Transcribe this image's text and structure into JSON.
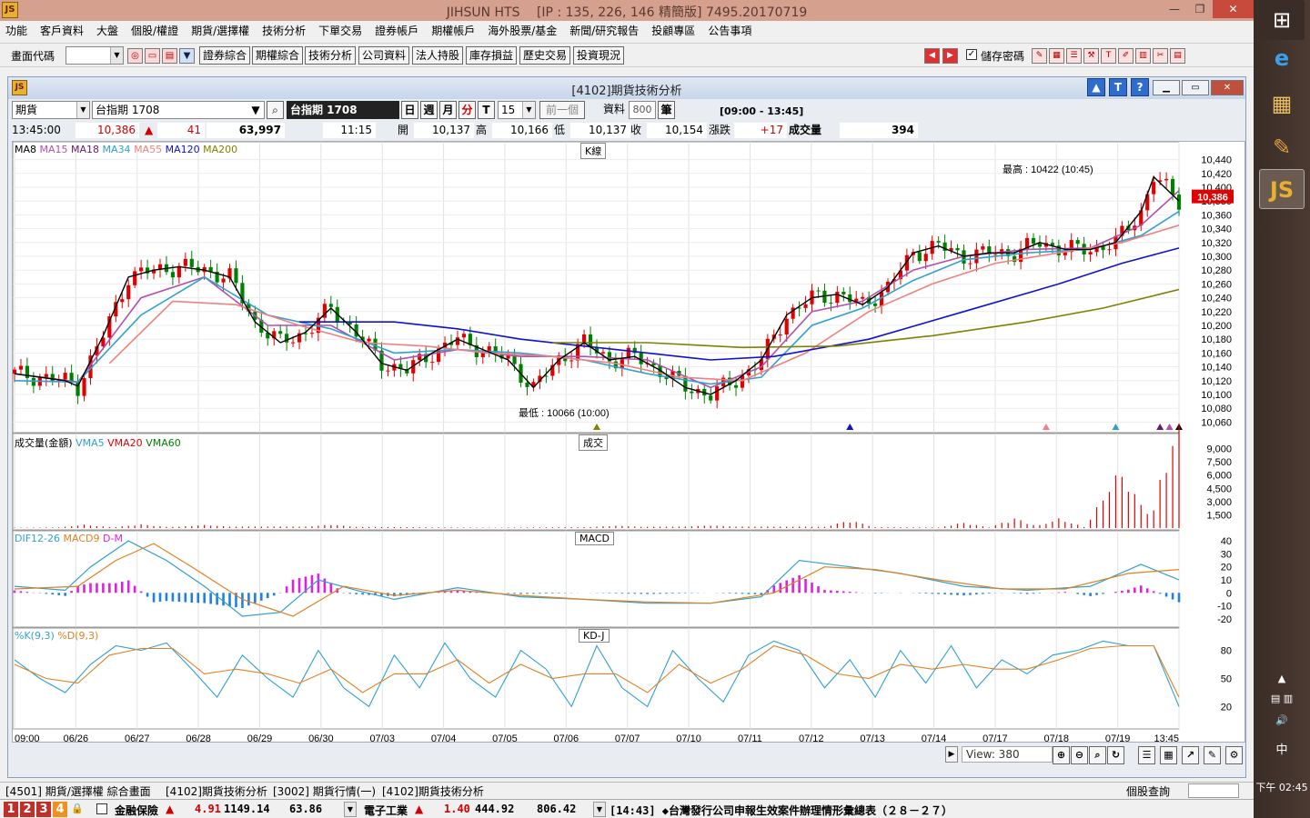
{
  "window": {
    "title": "JIHSUN HTS　  [IP : 135, 226, 146 精簡版] 7495.20170719",
    "logo_text": "JS"
  },
  "menu": [
    "功能",
    "客戶資料",
    "大盤",
    "個股/權證",
    "期貨/選擇權",
    "技術分析",
    "下單交易",
    "證券帳戶",
    "期權帳戶",
    "海外股票/基金",
    "新聞/研究報告",
    "投顧專區",
    "公告事項"
  ],
  "toolbar": {
    "code_label": "畫面代碼",
    "buttons": [
      "證券綜合",
      "期權綜合",
      "技術分析",
      "公司資料",
      "法人持股",
      "庫存損益",
      "歷史交易",
      "投資現況"
    ],
    "save_pw_label": "儲存密碼"
  },
  "child": {
    "title": "[4102]期貨技術分析",
    "market_select": "期貨",
    "contract_select": "台指期 1708",
    "contract_label": "台指期 1708",
    "periods": [
      "日",
      "週",
      "月",
      "分",
      "T"
    ],
    "interval": "15",
    "prev_btn": "前一個",
    "data_label": "資料",
    "data_count": "800",
    "unit_label": "筆",
    "session": "[09:00 - 13:45]"
  },
  "quote": {
    "time": "13:45:00",
    "price": "10,386",
    "change": "41",
    "volume_total": "63,997",
    "bar_time": "11:15",
    "open_label": "開",
    "open": "10,137",
    "high_label": "高",
    "high": "10,166",
    "low_label": "低",
    "low": "10,137",
    "close_label": "收",
    "close": "10,154",
    "chg_label": "漲跌",
    "chg": "+17",
    "vol_label": "成交量",
    "vol": "394"
  },
  "panels": {
    "k": {
      "title": "K線",
      "legend": [
        "MA8",
        "MA15",
        "MA18",
        "MA34",
        "MA55",
        "MA120",
        "MA200"
      ]
    },
    "vol": {
      "title": "成交",
      "legend": [
        "成交量(金額)",
        "VMA5",
        "VMA20",
        "VMA60"
      ]
    },
    "macd": {
      "title": "MACD",
      "legend": [
        "DIF12-26",
        "MACD9",
        "D-M"
      ]
    },
    "kd": {
      "title": "KD-J",
      "legend": [
        "%K(9,3)",
        "%D(9,3)"
      ]
    }
  },
  "colors": {
    "up": "#e00000",
    "down": "#008000",
    "ma8": "#000000",
    "ma15": "#b050b0",
    "ma18": "#6a1a6a",
    "ma34": "#30a0d0",
    "ma55": "#f08080",
    "ma120": "#1010d0",
    "ma200": "#808000",
    "vma5": "#30a0d0",
    "vma20": "#e00000",
    "vma60": "#008000",
    "dif": "#30a0d0",
    "macd": "#e08020",
    "osc_pos": "#e020e0",
    "osc_neg": "#2080e0",
    "k": "#30a0d0",
    "d": "#e08020"
  },
  "chart_data": [
    {
      "type": "line",
      "title": "K線",
      "high_annot": "最高 : 10422 (10:45)",
      "low_annot": "最低 : 10066 (10:00)",
      "last_price": "10,386",
      "y_ticks": [
        "10,440",
        "10,420",
        "10,400",
        "10,380",
        "10,360",
        "10,340",
        "10,320",
        "10,300",
        "10,280",
        "10,260",
        "10,240",
        "10,220",
        "10,200",
        "10,180",
        "10,160",
        "10,140",
        "10,120",
        "10,100",
        "10,080",
        "10,060"
      ],
      "ylim": [
        10050,
        10450
      ],
      "x_ticks": [
        "09:00",
        "06/26",
        "06/27",
        "06/28",
        "06/29",
        "06/30",
        "07/03",
        "07/04",
        "07/05",
        "07/06",
        "07/07",
        "07/10",
        "07/11",
        "07/12",
        "07/13",
        "07/14",
        "07/17",
        "07/18",
        "07/19",
        "13:45"
      ],
      "close_path": [
        [
          0,
          10130
        ],
        [
          4,
          10125
        ],
        [
          8,
          10120
        ],
        [
          10,
          10112
        ],
        [
          14,
          10185
        ],
        [
          18,
          10270
        ],
        [
          22,
          10280
        ],
        [
          26,
          10285
        ],
        [
          30,
          10280
        ],
        [
          34,
          10270
        ],
        [
          38,
          10205
        ],
        [
          42,
          10175
        ],
        [
          46,
          10190
        ],
        [
          50,
          10225
        ],
        [
          54,
          10190
        ],
        [
          58,
          10145
        ],
        [
          62,
          10135
        ],
        [
          66,
          10160
        ],
        [
          70,
          10180
        ],
        [
          74,
          10165
        ],
        [
          78,
          10150
        ],
        [
          82,
          10110
        ],
        [
          86,
          10150
        ],
        [
          90,
          10175
        ],
        [
          94,
          10150
        ],
        [
          98,
          10155
        ],
        [
          102,
          10135
        ],
        [
          106,
          10110
        ],
        [
          110,
          10100
        ],
        [
          114,
          10120
        ],
        [
          118,
          10150
        ],
        [
          122,
          10215
        ],
        [
          126,
          10240
        ],
        [
          130,
          10245
        ],
        [
          134,
          10230
        ],
        [
          138,
          10255
        ],
        [
          142,
          10305
        ],
        [
          146,
          10315
        ],
        [
          150,
          10300
        ],
        [
          154,
          10305
        ],
        [
          158,
          10305
        ],
        [
          162,
          10320
        ],
        [
          166,
          10310
        ],
        [
          170,
          10310
        ],
        [
          174,
          10320
        ],
        [
          178,
          10365
        ],
        [
          180,
          10415
        ],
        [
          184,
          10380
        ]
      ],
      "ma_paths": {
        "ma15": [
          [
            0,
            10130
          ],
          [
            10,
            10118
          ],
          [
            20,
            10240
          ],
          [
            30,
            10270
          ],
          [
            40,
            10200
          ],
          [
            50,
            10200
          ],
          [
            60,
            10150
          ],
          [
            70,
            10165
          ],
          [
            80,
            10155
          ],
          [
            90,
            10155
          ],
          [
            100,
            10150
          ],
          [
            110,
            10110
          ],
          [
            118,
            10140
          ],
          [
            126,
            10220
          ],
          [
            134,
            10235
          ],
          [
            142,
            10280
          ],
          [
            150,
            10300
          ],
          [
            160,
            10310
          ],
          [
            170,
            10312
          ],
          [
            178,
            10345
          ],
          [
            184,
            10395
          ]
        ],
        "ma34": [
          [
            0,
            10120
          ],
          [
            10,
            10118
          ],
          [
            20,
            10215
          ],
          [
            30,
            10270
          ],
          [
            40,
            10215
          ],
          [
            50,
            10195
          ],
          [
            60,
            10160
          ],
          [
            70,
            10165
          ],
          [
            80,
            10160
          ],
          [
            90,
            10150
          ],
          [
            100,
            10130
          ],
          [
            110,
            10115
          ],
          [
            118,
            10125
          ],
          [
            126,
            10200
          ],
          [
            134,
            10225
          ],
          [
            142,
            10265
          ],
          [
            150,
            10295
          ],
          [
            160,
            10305
          ],
          [
            170,
            10310
          ],
          [
            178,
            10330
          ],
          [
            184,
            10365
          ]
        ],
        "ma55": [
          [
            15,
            10145
          ],
          [
            25,
            10235
          ],
          [
            35,
            10230
          ],
          [
            45,
            10200
          ],
          [
            55,
            10175
          ],
          [
            65,
            10170
          ],
          [
            75,
            10160
          ],
          [
            85,
            10155
          ],
          [
            95,
            10145
          ],
          [
            105,
            10125
          ],
          [
            115,
            10120
          ],
          [
            125,
            10160
          ],
          [
            135,
            10220
          ],
          [
            145,
            10260
          ],
          [
            155,
            10290
          ],
          [
            165,
            10305
          ],
          [
            175,
            10320
          ],
          [
            184,
            10345
          ]
        ],
        "ma120": [
          [
            45,
            10205
          ],
          [
            60,
            10205
          ],
          [
            70,
            10195
          ],
          [
            80,
            10180
          ],
          [
            95,
            10165
          ],
          [
            110,
            10150
          ],
          [
            120,
            10155
          ],
          [
            135,
            10180
          ],
          [
            150,
            10220
          ],
          [
            165,
            10260
          ],
          [
            175,
            10290
          ],
          [
            184,
            10312
          ]
        ],
        "ma200": [
          [
            85,
            10175
          ],
          [
            100,
            10175
          ],
          [
            115,
            10168
          ],
          [
            130,
            10170
          ],
          [
            145,
            10185
          ],
          [
            160,
            10205
          ],
          [
            172,
            10225
          ],
          [
            184,
            10252
          ]
        ]
      }
    },
    {
      "type": "bar",
      "title": "成交",
      "y_ticks": [
        "9,000",
        "7,500",
        "6,000",
        "4,500",
        "3,000",
        "1,500"
      ],
      "ylim": [
        0,
        10500
      ],
      "bursts": [
        [
          11,
          300
        ],
        [
          20,
          300
        ],
        [
          30,
          200
        ],
        [
          50,
          250
        ],
        [
          95,
          150
        ],
        [
          110,
          150
        ],
        [
          132,
          800
        ],
        [
          150,
          600
        ],
        [
          158,
          1100
        ],
        [
          165,
          1000
        ],
        [
          173,
          4500
        ],
        [
          176,
          5200
        ],
        [
          182,
          4000
        ],
        [
          184,
          9800
        ]
      ]
    },
    {
      "type": "line",
      "title": "MACD",
      "y_ticks": [
        "40",
        "30",
        "20",
        "10",
        "0",
        "-10",
        "-20"
      ],
      "ylim": [
        -25,
        45
      ],
      "dif": [
        [
          0,
          5
        ],
        [
          8,
          2
        ],
        [
          12,
          20
        ],
        [
          18,
          40
        ],
        [
          24,
          25
        ],
        [
          30,
          5
        ],
        [
          36,
          -18
        ],
        [
          42,
          -15
        ],
        [
          48,
          10
        ],
        [
          54,
          2
        ],
        [
          60,
          -5
        ],
        [
          70,
          4
        ],
        [
          80,
          -3
        ],
        [
          90,
          -5
        ],
        [
          100,
          -8
        ],
        [
          110,
          -8
        ],
        [
          118,
          -3
        ],
        [
          124,
          25
        ],
        [
          132,
          20
        ],
        [
          140,
          15
        ],
        [
          150,
          5
        ],
        [
          160,
          2
        ],
        [
          170,
          5
        ],
        [
          178,
          22
        ],
        [
          184,
          10
        ]
      ],
      "macd": [
        [
          0,
          3
        ],
        [
          10,
          5
        ],
        [
          16,
          25
        ],
        [
          22,
          38
        ],
        [
          28,
          20
        ],
        [
          36,
          -5
        ],
        [
          44,
          -18
        ],
        [
          52,
          5
        ],
        [
          60,
          -2
        ],
        [
          70,
          2
        ],
        [
          80,
          -2
        ],
        [
          90,
          -5
        ],
        [
          100,
          -7
        ],
        [
          110,
          -8
        ],
        [
          120,
          0
        ],
        [
          128,
          20
        ],
        [
          136,
          18
        ],
        [
          146,
          10
        ],
        [
          156,
          3
        ],
        [
          166,
          3
        ],
        [
          176,
          15
        ],
        [
          184,
          18
        ]
      ]
    },
    {
      "type": "line",
      "title": "KD-J",
      "y_ticks": [
        "80",
        "50",
        "20"
      ],
      "ylim": [
        0,
        100
      ],
      "k": [
        [
          0,
          70
        ],
        [
          4,
          50
        ],
        [
          8,
          35
        ],
        [
          12,
          65
        ],
        [
          16,
          85
        ],
        [
          20,
          80
        ],
        [
          24,
          88
        ],
        [
          28,
          60
        ],
        [
          32,
          30
        ],
        [
          36,
          75
        ],
        [
          40,
          50
        ],
        [
          44,
          30
        ],
        [
          48,
          80
        ],
        [
          52,
          40
        ],
        [
          56,
          20
        ],
        [
          60,
          75
        ],
        [
          64,
          40
        ],
        [
          68,
          88
        ],
        [
          72,
          50
        ],
        [
          76,
          30
        ],
        [
          80,
          80
        ],
        [
          84,
          60
        ],
        [
          88,
          20
        ],
        [
          92,
          85
        ],
        [
          96,
          40
        ],
        [
          100,
          20
        ],
        [
          104,
          80
        ],
        [
          108,
          50
        ],
        [
          112,
          25
        ],
        [
          116,
          75
        ],
        [
          120,
          90
        ],
        [
          124,
          80
        ],
        [
          128,
          40
        ],
        [
          132,
          70
        ],
        [
          136,
          30
        ],
        [
          140,
          80
        ],
        [
          144,
          45
        ],
        [
          148,
          85
        ],
        [
          152,
          40
        ],
        [
          156,
          70
        ],
        [
          160,
          55
        ],
        [
          164,
          75
        ],
        [
          168,
          80
        ],
        [
          172,
          90
        ],
        [
          176,
          85
        ],
        [
          180,
          85
        ],
        [
          184,
          20
        ]
      ],
      "d": [
        [
          0,
          65
        ],
        [
          5,
          50
        ],
        [
          10,
          45
        ],
        [
          15,
          75
        ],
        [
          20,
          82
        ],
        [
          25,
          82
        ],
        [
          30,
          55
        ],
        [
          35,
          60
        ],
        [
          40,
          55
        ],
        [
          45,
          45
        ],
        [
          50,
          60
        ],
        [
          55,
          35
        ],
        [
          60,
          55
        ],
        [
          65,
          55
        ],
        [
          70,
          70
        ],
        [
          75,
          45
        ],
        [
          80,
          65
        ],
        [
          85,
          50
        ],
        [
          90,
          55
        ],
        [
          95,
          55
        ],
        [
          100,
          35
        ],
        [
          105,
          65
        ],
        [
          110,
          45
        ],
        [
          115,
          60
        ],
        [
          120,
          85
        ],
        [
          125,
          75
        ],
        [
          130,
          55
        ],
        [
          135,
          50
        ],
        [
          140,
          65
        ],
        [
          145,
          60
        ],
        [
          150,
          65
        ],
        [
          155,
          60
        ],
        [
          160,
          60
        ],
        [
          165,
          70
        ],
        [
          170,
          82
        ],
        [
          175,
          85
        ],
        [
          180,
          85
        ],
        [
          184,
          30
        ]
      ]
    }
  ],
  "scroll": {
    "view_label": "View: 380"
  },
  "tabs": [
    "[4501] 期貨/選擇權 綜合畫面",
    "[4102]期貨技術分析",
    "[3002] 期貨行情(一)",
    "[4102]期貨技術分析"
  ],
  "tabs_right": "個股查詢",
  "status": {
    "nums": [
      "1",
      "2",
      "3",
      "4"
    ],
    "item1_name": "金融保險",
    "item1_chg": "4.91",
    "item1_val": "1149.14",
    "item1_b": "63.86",
    "item2_name": "電子工業",
    "item2_chg": "1.40",
    "item2_val": "444.92",
    "item2_b": "806.42",
    "news": "[14:43] ◆台灣發行公司申報生效案件辦理情形彙總表（２８－２７）"
  },
  "taskbar": {
    "ime": "中",
    "clock": "下午 02:45"
  }
}
